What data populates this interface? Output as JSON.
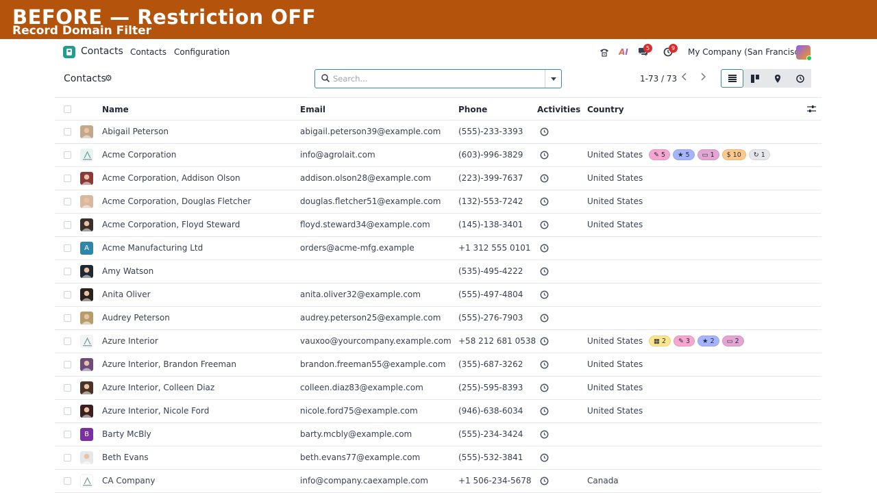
{
  "banner": {
    "title": "BEFORE — Restriction OFF",
    "subtitle": "Record Domain Filter"
  },
  "navbar": {
    "app_name": "Contacts",
    "menu": [
      "Contacts",
      "Configuration"
    ],
    "company": "My Company (San Francisco)",
    "chat_count": "5",
    "activity_count": "9",
    "ai_label": "AI"
  },
  "control": {
    "breadcrumb": "Contacts",
    "search_placeholder": "Search...",
    "pager": "1-73 / 73"
  },
  "table": {
    "headers": {
      "name": "Name",
      "email": "Email",
      "phone": "Phone",
      "activities": "Activities",
      "country": "Country"
    },
    "rows": [
      {
        "name": "Abigail Peterson",
        "email": "abigail.peterson39@example.com",
        "phone": "(555)-233-3393",
        "country": "",
        "avatar": "photo",
        "avatar_color": "#c4a78a",
        "tags": []
      },
      {
        "name": "Acme Corporation",
        "email": "info@agrolait.com",
        "phone": "(603)-996-3829",
        "country": "United States",
        "avatar": "logo",
        "avatar_color": "#e6f4f1",
        "tags": [
          {
            "icon": "✎",
            "value": "5",
            "color": "#f6a6cf"
          },
          {
            "icon": "★",
            "value": "5",
            "color": "#a5b4fc"
          },
          {
            "icon": "▭",
            "value": "1",
            "color": "#e3a5d3"
          },
          {
            "icon": "$",
            "value": "10",
            "color": "#fcc98a"
          },
          {
            "icon": "↻",
            "value": "1",
            "color": "#e5e7eb"
          }
        ]
      },
      {
        "name": "Acme Corporation, Addison Olson",
        "email": "addison.olson28@example.com",
        "phone": "(223)-399-7637",
        "country": "United States",
        "avatar": "photo",
        "avatar_color": "#8b3a3a",
        "tags": []
      },
      {
        "name": "Acme Corporation, Douglas Fletcher",
        "email": "douglas.fletcher51@example.com",
        "phone": "(132)-553-7242",
        "country": "United States",
        "avatar": "photo",
        "avatar_color": "#d9b8a0",
        "tags": []
      },
      {
        "name": "Acme Corporation, Floyd Steward",
        "email": "floyd.steward34@example.com",
        "phone": "(145)-138-3401",
        "country": "United States",
        "avatar": "photo",
        "avatar_color": "#3b2f2a",
        "tags": []
      },
      {
        "name": "Acme Manufacturing Ltd",
        "email": "orders@acme-mfg.example",
        "phone": "+1 312 555 0101",
        "country": "",
        "avatar": "letter",
        "letter": "A",
        "avatar_color": "#2e86ab",
        "tags": []
      },
      {
        "name": "Amy Watson",
        "email": "",
        "phone": "(535)-495-4222",
        "country": "",
        "avatar": "photo",
        "avatar_color": "#1f2933",
        "tags": []
      },
      {
        "name": "Anita Oliver",
        "email": "anita.oliver32@example.com",
        "phone": "(555)-497-4804",
        "country": "",
        "avatar": "photo",
        "avatar_color": "#2a211d",
        "tags": []
      },
      {
        "name": "Audrey Peterson",
        "email": "audrey.peterson25@example.com",
        "phone": "(555)-276-7903",
        "country": "",
        "avatar": "photo",
        "avatar_color": "#b89b6a",
        "tags": []
      },
      {
        "name": "Azure Interior",
        "email": "vauxoo@yourcompany.example.com",
        "phone": "+58 212 681 0538",
        "country": "United States",
        "avatar": "logo",
        "avatar_color": "#f3f4f6",
        "tags": [
          {
            "icon": "▦",
            "value": "2",
            "color": "#fde58a"
          },
          {
            "icon": "✎",
            "value": "3",
            "color": "#f6a6cf"
          },
          {
            "icon": "★",
            "value": "2",
            "color": "#a5b4fc"
          },
          {
            "icon": "▭",
            "value": "2",
            "color": "#e3a5d3"
          }
        ]
      },
      {
        "name": "Azure Interior, Brandon Freeman",
        "email": "brandon.freeman55@example.com",
        "phone": "(355)-687-3262",
        "country": "United States",
        "avatar": "photo",
        "avatar_color": "#6d4c7d",
        "tags": []
      },
      {
        "name": "Azure Interior, Colleen Diaz",
        "email": "colleen.diaz83@example.com",
        "phone": "(255)-595-8393",
        "country": "United States",
        "avatar": "photo",
        "avatar_color": "#4a3326",
        "tags": []
      },
      {
        "name": "Azure Interior, Nicole Ford",
        "email": "nicole.ford75@example.com",
        "phone": "(946)-638-6034",
        "country": "United States",
        "avatar": "photo",
        "avatar_color": "#3a1f1f",
        "tags": []
      },
      {
        "name": "Barty McBly",
        "email": "barty.mcbly@example.com",
        "phone": "(555)-234-3424",
        "country": "",
        "avatar": "letter",
        "letter": "B",
        "avatar_color": "#7b2fa1",
        "tags": []
      },
      {
        "name": "Beth Evans",
        "email": "beth.evans77@example.com",
        "phone": "(555)-532-3841",
        "country": "",
        "avatar": "photo",
        "avatar_color": "#e5e7eb",
        "tags": []
      },
      {
        "name": "CA Company",
        "email": "info@company.caexample.com",
        "phone": "+1 506-234-5678",
        "country": "Canada",
        "avatar": "logo",
        "avatar_color": "#ffffff",
        "tags": []
      }
    ]
  }
}
